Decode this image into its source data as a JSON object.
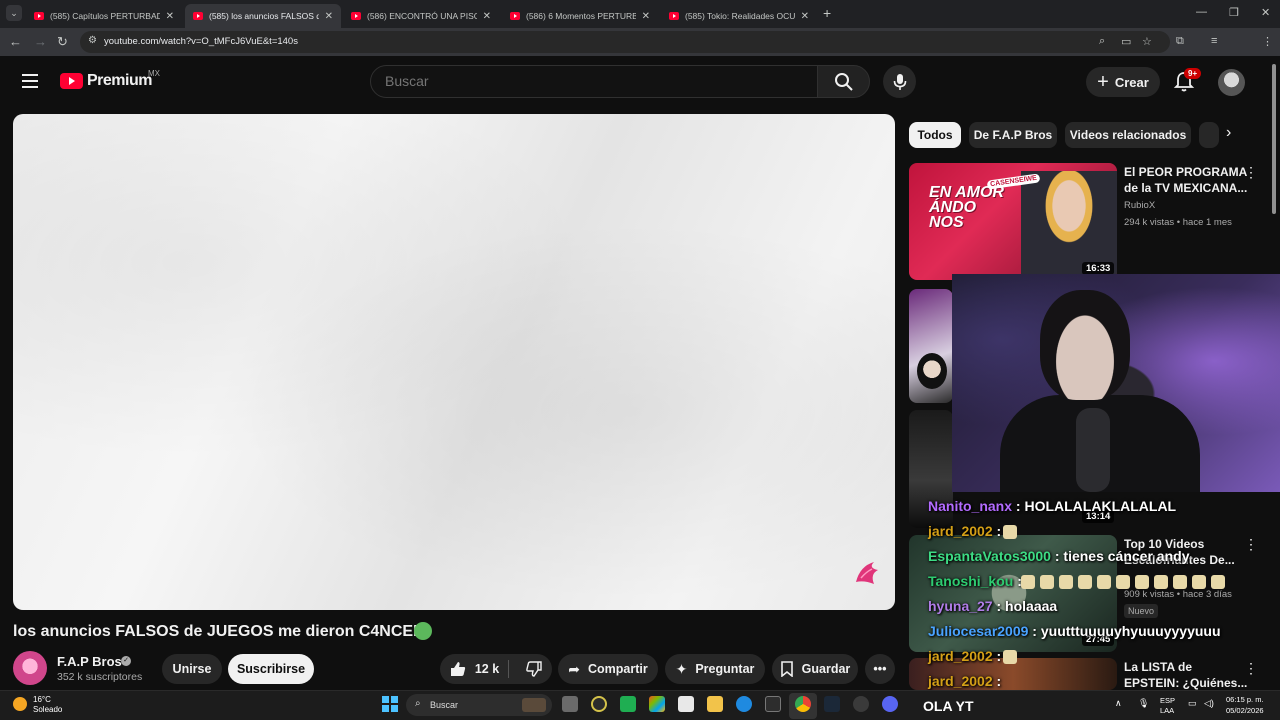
{
  "browser": {
    "tabs": [
      {
        "label": "(585) Capítulos PERTURBADORES"
      },
      {
        "label": "(585) los anuncios FALSOS de JUEGOS"
      },
      {
        "label": "(586) ENCONTRÓ UNA PISCINA"
      },
      {
        "label": "(586) 6 Momentos PERTURBADORES"
      },
      {
        "label": "(585) Tokio: Realidades OCULTAS"
      }
    ],
    "url": "youtube.com/watch?v=O_tMFcJ6VuE&t=140s",
    "new_tab": "+",
    "close_glyph": "✕"
  },
  "header": {
    "logo_text": "Premium",
    "region": "MX",
    "search_placeholder": "Buscar",
    "create_label": "Crear",
    "notification_count": "9+"
  },
  "video": {
    "title": "los anuncios FALSOS de JUEGOS me dieron C4NCER",
    "channel": "F.A.P Bros",
    "subscribers": "352 k suscriptores",
    "join_label": "Unirse",
    "subscribe_label": "Suscribirse",
    "likes": "12 k",
    "share_label": "Compartir",
    "ask_label": "Preguntar",
    "save_label": "Guardar"
  },
  "chips": [
    {
      "label": "Todos",
      "active": true
    },
    {
      "label": "De F.A.P Bros",
      "active": false
    },
    {
      "label": "Videos relacionados",
      "active": false
    }
  ],
  "recommendations": [
    {
      "title_line1": "El PEOR PROGRAMA",
      "title_line2": "de la TV MEXICANA...",
      "channel": "RubioX",
      "meta": "294 k vistas • hace 1 mes",
      "duration": "16:33",
      "thumb_text": "EN AMOR ÁNDO NOS",
      "thumb_tag": "CASENSEIWE"
    },
    {
      "duration": "13:14"
    },
    {
      "title_line1": "Top 10 Videos",
      "title_line2": "Escalofriantes De...",
      "meta": "909 k vistas • hace 3 días",
      "badge": "Nuevo",
      "duration": "27:45"
    },
    {
      "title_line1": "La LISTA de",
      "title_line2": "EPSTEIN: ¿Quiénes..."
    }
  ],
  "chat": [
    {
      "user": "Nanito_nanx",
      "message": "HOLALALAKLALALAL",
      "color": "#b36bff"
    },
    {
      "user": "jard_2002",
      "message": "",
      "color": "#d4a017"
    },
    {
      "user": "EspantaVatos3000",
      "message": "tienes cáncer andy",
      "color": "#3ddc84"
    },
    {
      "user": "Tanoshi_kou",
      "message": "",
      "color": "#2ecc71"
    },
    {
      "user": "hyuna_27",
      "message": "holaaaa",
      "color": "#b07de8"
    },
    {
      "user": "Juliocesar2009",
      "message": "yuutttuuuuyhyuuuyyyyuuu",
      "color": "#4aa3ff"
    },
    {
      "user": "jard_2002",
      "message": "",
      "color": "#d4a017"
    },
    {
      "user": "jard_2002",
      "message": "",
      "color": "#d4a017"
    }
  ],
  "taskbar": {
    "temperature": "16°C",
    "condition": "Soleado",
    "search_label": "Buscar",
    "ola_text": "OLA YT",
    "lang1": "ESP",
    "lang2": "LAA",
    "time": "06:15 p. m.",
    "date": "05/02/2026"
  },
  "colors": {
    "brand_red": "#ff0033",
    "background": "#0f0f0f",
    "chip_bg": "#272727"
  }
}
